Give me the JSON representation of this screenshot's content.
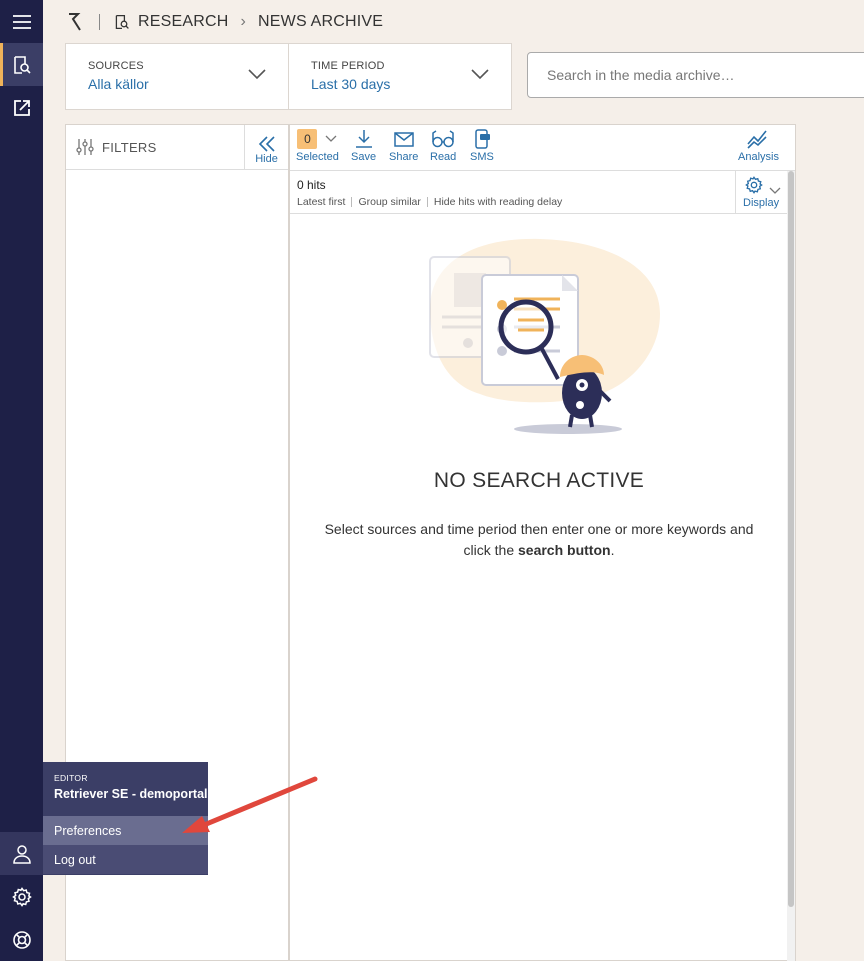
{
  "breadcrumb": {
    "section": "RESEARCH",
    "page": "NEWS ARCHIVE",
    "icons": [
      "retriever-logo-icon",
      "research-icon",
      "chevron-right-icon"
    ]
  },
  "rail": {
    "icons": [
      "menu-icon",
      "research-icon",
      "external-link-icon",
      "user-icon",
      "gear-icon",
      "help-lifebuoy-icon"
    ]
  },
  "sources": {
    "label": "SOURCES",
    "value": "Alla källor"
  },
  "time_period": {
    "label": "TIME PERIOD",
    "value": "Last 30 days"
  },
  "search": {
    "placeholder": "Search in the media archive…"
  },
  "filters": {
    "title": "FILTERS",
    "hide_label": "Hide"
  },
  "toolbar": {
    "selected_count": "0",
    "selected_label": "Selected",
    "save_label": "Save",
    "share_label": "Share",
    "read_label": "Read",
    "sms_label": "SMS",
    "analysis_label": "Analysis"
  },
  "hits": {
    "count_text": "0 hits",
    "options": [
      "Latest first",
      "Group similar",
      "Hide hits with reading delay"
    ],
    "display_label": "Display"
  },
  "empty_state": {
    "title": "NO SEARCH ACTIVE",
    "text_before": "Select sources and time period then enter one or more keywords and click the ",
    "text_bold": "search button",
    "text_after": "."
  },
  "user_menu": {
    "role": "EDITOR",
    "org": "Retriever SE - demoportal",
    "preferences": "Preferences",
    "logout": "Log out"
  },
  "colors": {
    "rail": "#1e2047",
    "rail_active": "#3b3e66",
    "accent": "#f0b35a",
    "link": "#2a6fa8",
    "arrow": "#e0473c",
    "background": "#f5efe9"
  }
}
